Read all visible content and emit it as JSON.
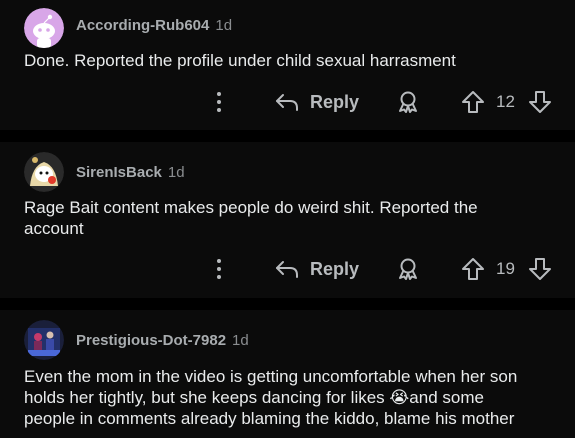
{
  "comments": [
    {
      "username": "According-Rub604",
      "age": "1d",
      "text": "Done. Reported the profile under child sexual harrasment",
      "reply_label": "Reply",
      "score": "12"
    },
    {
      "username": "SirenIsBack",
      "age": "1d",
      "text": "Rage Bait content makes people do weird shit. Reported the account",
      "reply_label": "Reply",
      "score": "19"
    },
    {
      "username": "Prestigious-Dot-7982",
      "age": "1d",
      "text_before_emoji": "Even the mom in the video is getting uncomfortable when her son holds her tightly, but she keeps dancing for likes ",
      "emoji": "😭",
      "text_after_emoji": "and some people in comments already blaming the kiddo, blame his mother"
    }
  ],
  "icons": {
    "more": "more-options-icon",
    "reply": "reply-arrow-icon",
    "award": "award-icon",
    "upvote": "upvote-arrow-icon",
    "downvote": "downvote-arrow-icon"
  },
  "colors": {
    "background": "#000000",
    "card": "#0b0b0b",
    "text": "#e9ebec",
    "muted": "#a8acaf"
  }
}
